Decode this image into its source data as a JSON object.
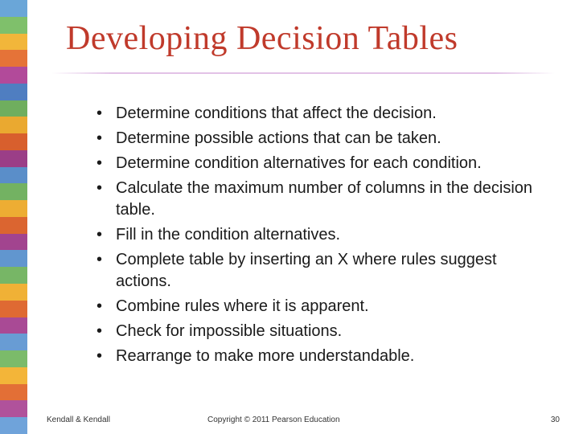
{
  "sidebar_colors": [
    "#6aa6d8",
    "#7fc06b",
    "#f2b63a",
    "#e57338",
    "#b24a9a",
    "#4f7ec1",
    "#6fae5e",
    "#eaa930",
    "#d85f2d",
    "#9b3e87",
    "#5a8ec9",
    "#73b262",
    "#edad33",
    "#db6530",
    "#a2448f",
    "#6196cf",
    "#77b666",
    "#f0b136",
    "#df6a33",
    "#a94a95",
    "#689cd4",
    "#7bbb6a",
    "#f3b539",
    "#e36f36",
    "#b0529b",
    "#6fa3da"
  ],
  "title": "Developing Decision Tables",
  "bullets": [
    "Determine conditions that affect the decision.",
    "Determine possible actions that can be taken.",
    "Determine condition alternatives for each condition.",
    "Calculate the maximum number of columns in the decision table.",
    "Fill in the condition alternatives.",
    "Complete table by inserting an X where rules suggest actions.",
    "Combine rules where it is apparent.",
    "Check for impossible situations.",
    "Rearrange to make more understandable."
  ],
  "footer": {
    "author": "Kendall & Kendall",
    "copyright": "Copyright © 2011 Pearson Education",
    "page": "30"
  }
}
